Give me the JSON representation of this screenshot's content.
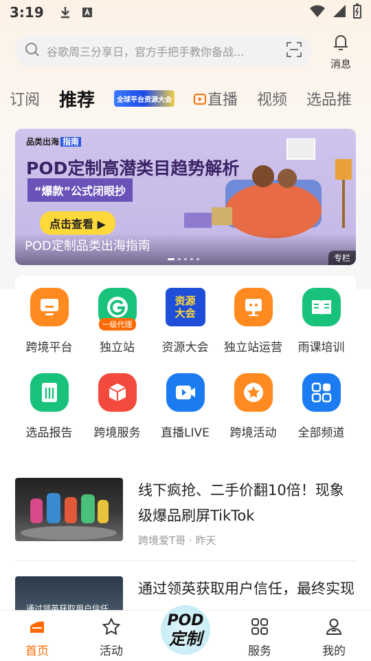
{
  "status_bar": {
    "time": "3:19"
  },
  "search": {
    "placeholder": "谷歌周三分享日，官方手把手教你备战...",
    "messages_label": "消息"
  },
  "tabs": [
    {
      "label": "订阅",
      "active": false
    },
    {
      "label": "推荐",
      "active": true
    },
    {
      "label": "全球平台资源大会",
      "type": "banner"
    },
    {
      "label": "直播",
      "active": false,
      "icon": "live-play-icon"
    },
    {
      "label": "视频",
      "active": false
    },
    {
      "label": "选品推",
      "active": false
    }
  ],
  "banner": {
    "brand": "品类出海",
    "brand_tag": "指南",
    "headline": "POD定制高潜类目趋势解析",
    "tag": "“爆款”公式闭眼抄",
    "cta": "点击查看 ▶",
    "caption": "POD定制品类出海指南",
    "badge": "专栏",
    "slide_count": 5,
    "active_slide": 1
  },
  "quick_entries": [
    {
      "label": "跨境平台",
      "icon": "monitor-icon",
      "color": "#ff8a1f"
    },
    {
      "label": "独立站",
      "icon": "g-logo-icon",
      "color": "#19c27a",
      "badge": "一级代理"
    },
    {
      "label": "资源大会",
      "icon": "resource-conference-icon",
      "color": "#1f4fd8",
      "text": "资源大会"
    },
    {
      "label": "独立站运营",
      "icon": "ops-screen-icon",
      "color": "#ff8a1f"
    },
    {
      "label": "雨课培训",
      "icon": "book-icon",
      "color": "#19c27a"
    },
    {
      "label": "选品报告",
      "icon": "report-icon",
      "color": "#19c27a"
    },
    {
      "label": "跨境服务",
      "icon": "box-icon",
      "color": "#f24b3d"
    },
    {
      "label": "直播LIVE",
      "icon": "video-camera-icon",
      "color": "#1a7cf0"
    },
    {
      "label": "跨境活动",
      "icon": "star-icon",
      "color": "#ff8a1f"
    },
    {
      "label": "全部频道",
      "icon": "grid-apps-icon",
      "color": "#1a7cf0"
    }
  ],
  "news": [
    {
      "title": "线下疯抢、二手价翻10倍！现象级爆品刷屏TikTok",
      "author": "跨境爱T哥",
      "time": "昨天",
      "meta": "跨境爱T哥 · 昨天"
    },
    {
      "title": "通过领英获取用户信任，最终实现",
      "thumb_text": "通过领英获取用户信任"
    }
  ],
  "bottom_nav": [
    {
      "label": "首页",
      "icon": "home-icon",
      "active": true
    },
    {
      "label": "活动",
      "icon": "star-outline-icon",
      "active": false
    },
    {
      "label": "POD定制",
      "icon": "pod-logo",
      "center": true,
      "line1": "POD",
      "line2": "定制"
    },
    {
      "label": "服务",
      "icon": "services-grid-icon",
      "active": false
    },
    {
      "label": "我的",
      "icon": "profile-icon",
      "active": false
    }
  ],
  "colors": {
    "accent": "#ff6a00"
  }
}
